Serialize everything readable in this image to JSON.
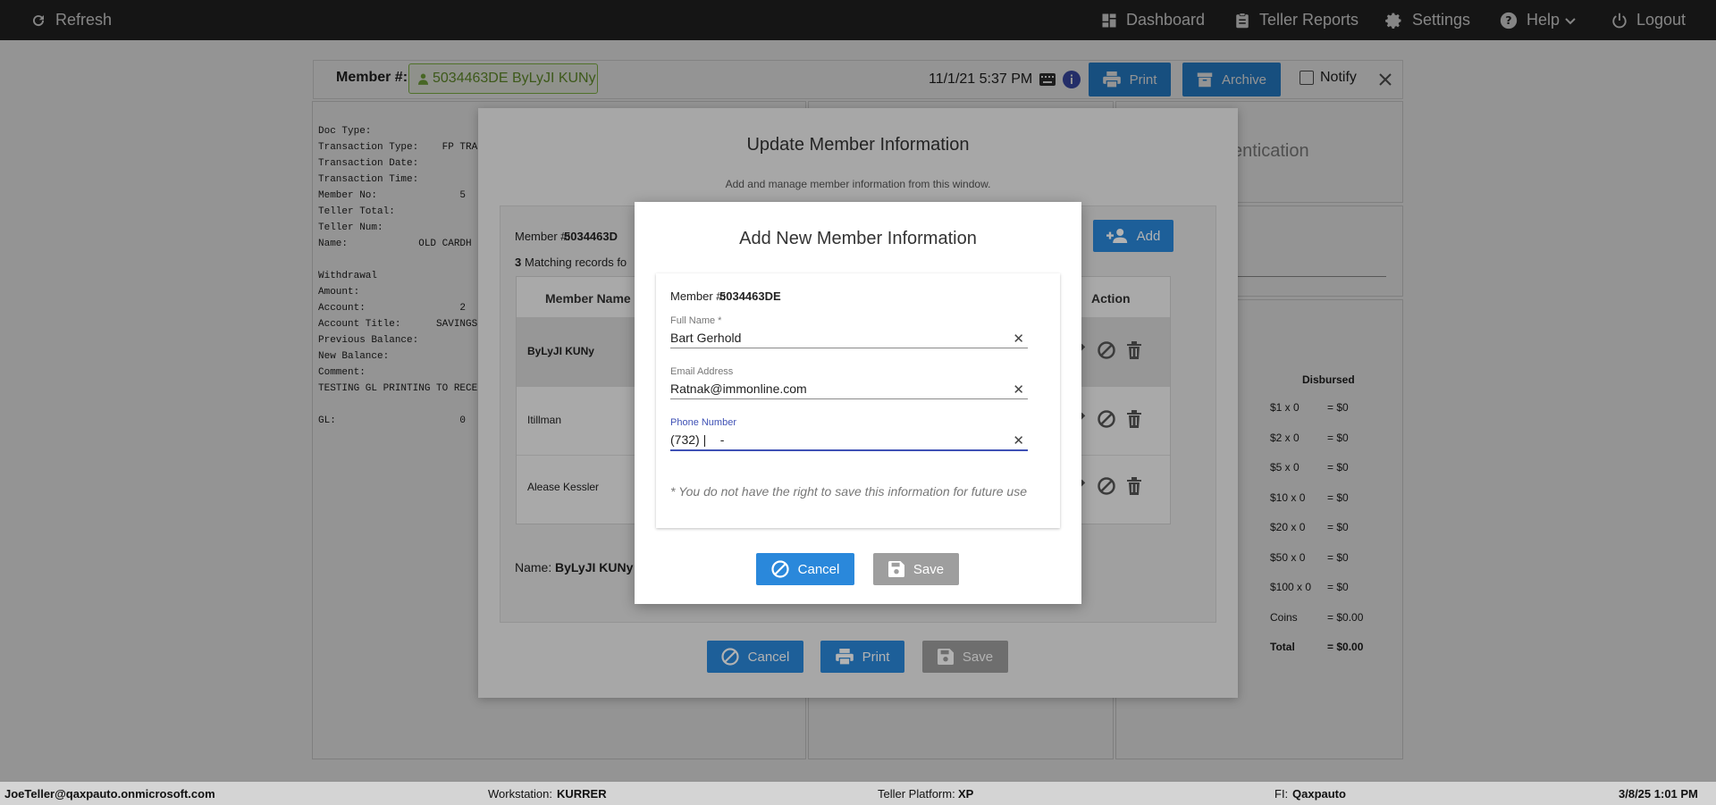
{
  "topbar": {
    "refresh": "Refresh",
    "dashboard": "Dashboard",
    "teller_reports": "Teller Reports",
    "settings": "Settings",
    "help": "Help",
    "logout": "Logout"
  },
  "memberbar": {
    "label": "Member #:",
    "member_chip": "5034463DE ByLyJI KUNy",
    "datetime": "11/1/21 5:37 PM",
    "print": "Print",
    "archive": "Archive",
    "notify": "Notify"
  },
  "receipt_lines": "Doc Type:\nTransaction Type:    FP TRA\nTransaction Date:\nTransaction Time:\nMember No:              5\nTeller Total:\nTeller Num:\nName:            OLD CARDH\n\nWithdrawal\nAmount:\nAccount:                2\nAccount Title:      SAVINGS\nPrevious Balance:\nNew Balance:\nComment:\nTESTING GL PRINTING TO RECE\n\nGL:                     0",
  "auth_panel_title": "entication",
  "disbursed": {
    "header": "Disbursed",
    "rows": [
      {
        "label": "$1 x 0",
        "value": "= $0"
      },
      {
        "label": "$2 x 0",
        "value": "= $0"
      },
      {
        "label": "$5 x 0",
        "value": "= $0"
      },
      {
        "label": "$10 x 0",
        "value": "= $0"
      },
      {
        "label": "$20 x 0",
        "value": "= $0"
      },
      {
        "label": "$50 x 0",
        "value": "= $0"
      },
      {
        "label": "$100 x 0",
        "value": "= $0"
      },
      {
        "label": "Coins",
        "value": "= $0.00"
      },
      {
        "label": "Total",
        "value": "= $0.00"
      }
    ]
  },
  "update_modal": {
    "title": "Update Member Information",
    "subtitle": "Add and manage member information from this window.",
    "member_label": "Member #:",
    "member_no": "5034463D",
    "matching_count": "3",
    "matching_text": "Matching records fo",
    "add_label": "Add",
    "col_member_name": "Member Name",
    "col_action": "Action",
    "rows": [
      "ByLyJI KUNy",
      "Itillman",
      "Alease Kessler"
    ],
    "name_label": "Name:",
    "name_value": "ByLyJI KUNy",
    "cancel": "Cancel",
    "print": "Print",
    "save": "Save"
  },
  "add_modal": {
    "title": "Add New Member Information",
    "member_label": "Member #:",
    "member_no": "5034463DE",
    "full_name_label": "Full Name *",
    "full_name": "Bart Gerhold",
    "email_label": "Email Address",
    "email": "Ratnak@immonline.com",
    "phone_label": "Phone Number",
    "phone": "(732) |    -",
    "note": "* You do not have the right to save this information for future use",
    "cancel": "Cancel",
    "save": "Save"
  },
  "statusbar": {
    "user": "JoeTeller@qaxpauto.onmicrosoft.com",
    "workstation_label": "Workstation:",
    "workstation": "KURRER",
    "platform_label": "Teller Platform:",
    "platform": "XP",
    "fi_label": "FI:",
    "fi": "Qaxpauto",
    "datetime": "3/8/25 1:01 PM"
  }
}
